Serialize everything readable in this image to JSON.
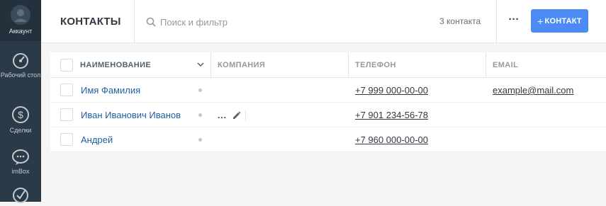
{
  "sidebar": {
    "account_label": "Аккаунт",
    "dashboard_label": "Рабочий стол",
    "deals_label": "Сделки",
    "imbox_label": "imBox"
  },
  "header": {
    "title": "КОНТАКТЫ",
    "search_placeholder": "Поиск и фильтр",
    "count": "3 контакта",
    "more": "···",
    "add_button": "КОНТАКТ",
    "add_button_plus": "+"
  },
  "table": {
    "columns": [
      "НАИМЕНОВАНИЕ",
      "КОМПАНИЯ",
      "ТЕЛЕФОН",
      "EMAIL"
    ],
    "rows": [
      {
        "name": "Имя Фамилия",
        "company": "",
        "phone": "+7 999 000-00-00",
        "email": "example@mail.com"
      },
      {
        "name": "Иван Иванович Иванов",
        "company": "...",
        "phone": "+7 901 234-56-78",
        "email": ""
      },
      {
        "name": "Андрей",
        "company": "",
        "phone": "+7 960 000-00-00",
        "email": ""
      }
    ]
  },
  "colors": {
    "accent": "#4c8bf5",
    "sidebar": "#2b3a47",
    "link": "#1f5fa0",
    "highlight": "#7de87d"
  }
}
